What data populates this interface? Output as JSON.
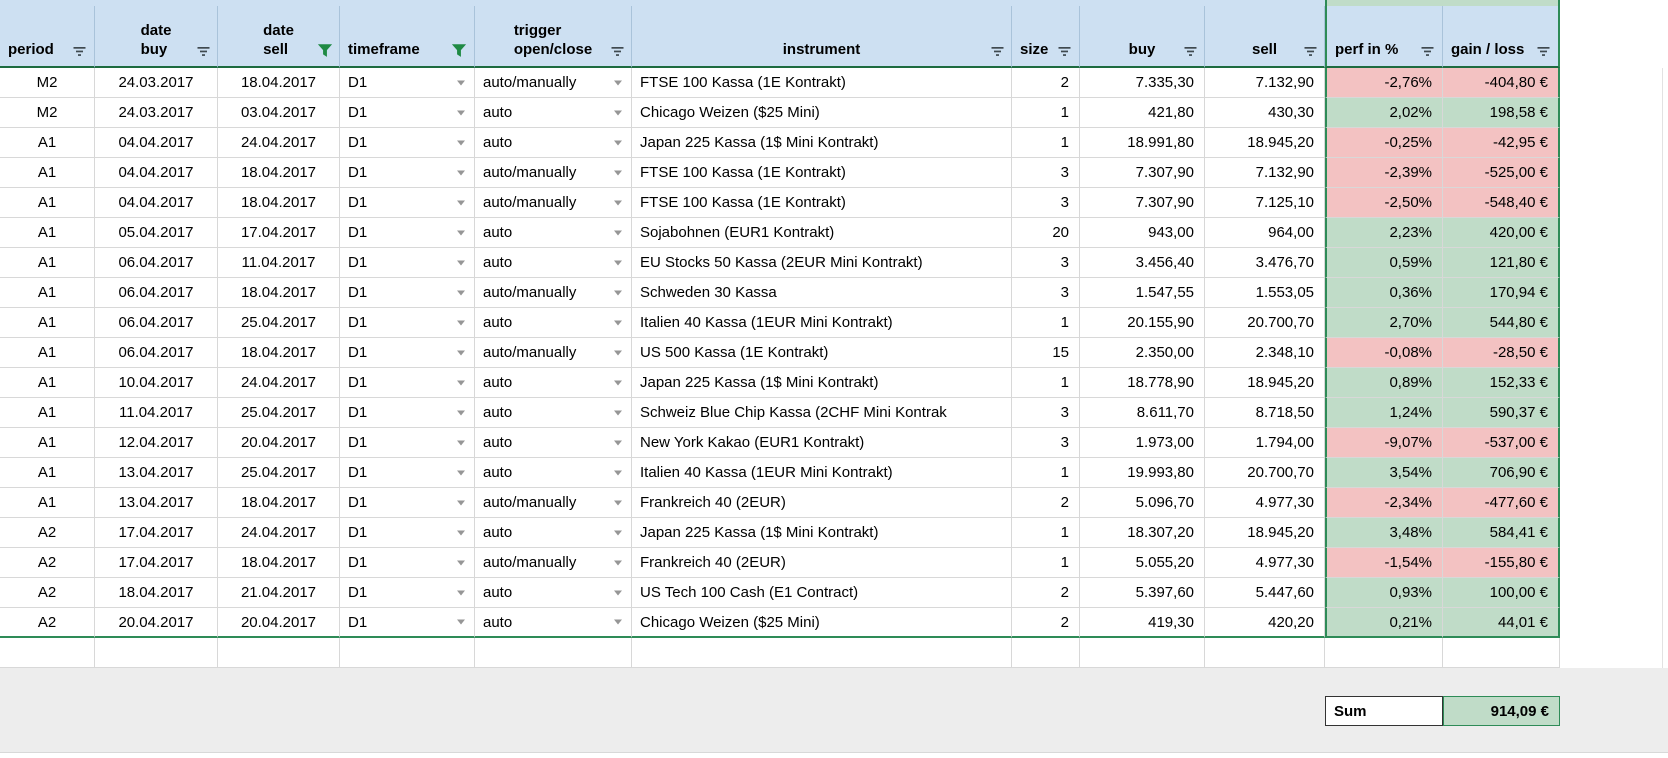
{
  "colors": {
    "header_bg": "#CDE0F2",
    "positive_bg": "#C0DCC8",
    "negative_bg": "#F3C2C2",
    "range_border_green": "#2E8B57",
    "header_underline_green": "#1D6B40",
    "filter_active_green": "#1F8A44",
    "filter_inactive": "#3F4A50",
    "band_grey": "#EDEDED"
  },
  "table": {
    "columns": [
      {
        "label": "period",
        "filter": "inactive"
      },
      {
        "label": "date\nbuy",
        "filter": "inactive"
      },
      {
        "label": "date\nsell",
        "filter": "active"
      },
      {
        "label": "timeframe",
        "filter": "active"
      },
      {
        "label": "trigger\nopen/close",
        "filter": "inactive"
      },
      {
        "label": "instrument",
        "filter": "inactive"
      },
      {
        "label": "size",
        "filter": "inactive"
      },
      {
        "label": "buy",
        "filter": "inactive"
      },
      {
        "label": "sell",
        "filter": "inactive"
      },
      {
        "label": "perf in %",
        "filter": "inactive"
      },
      {
        "label": "gain / loss",
        "filter": "inactive"
      }
    ],
    "rows": [
      {
        "period": "M2",
        "date_buy": "24.03.2017",
        "date_sell": "18.04.2017",
        "timeframe": "D1",
        "trigger": "auto/manually",
        "instrument": "FTSE 100 Kassa (1E Kontrakt)",
        "size": "2",
        "buy": "7.335,30",
        "sell": "7.132,90",
        "perf": "-2,76%",
        "gain": "-404,80 €",
        "sign": "neg"
      },
      {
        "period": "M2",
        "date_buy": "24.03.2017",
        "date_sell": "03.04.2017",
        "timeframe": "D1",
        "trigger": "auto",
        "instrument": "Chicago Weizen ($25 Mini)",
        "size": "1",
        "buy": "421,80",
        "sell": "430,30",
        "perf": "2,02%",
        "gain": "198,58 €",
        "sign": "pos"
      },
      {
        "period": "A1",
        "date_buy": "04.04.2017",
        "date_sell": "24.04.2017",
        "timeframe": "D1",
        "trigger": "auto",
        "instrument": "Japan 225 Kassa (1$ Mini Kontrakt)",
        "size": "1",
        "buy": "18.991,80",
        "sell": "18.945,20",
        "perf": "-0,25%",
        "gain": "-42,95 €",
        "sign": "neg"
      },
      {
        "period": "A1",
        "date_buy": "04.04.2017",
        "date_sell": "18.04.2017",
        "timeframe": "D1",
        "trigger": "auto/manually",
        "instrument": "FTSE 100 Kassa (1E Kontrakt)",
        "size": "3",
        "buy": "7.307,90",
        "sell": "7.132,90",
        "perf": "-2,39%",
        "gain": "-525,00 €",
        "sign": "neg"
      },
      {
        "period": "A1",
        "date_buy": "04.04.2017",
        "date_sell": "18.04.2017",
        "timeframe": "D1",
        "trigger": "auto/manually",
        "instrument": "FTSE 100 Kassa (1E Kontrakt)",
        "size": "3",
        "buy": "7.307,90",
        "sell": "7.125,10",
        "perf": "-2,50%",
        "gain": "-548,40 €",
        "sign": "neg"
      },
      {
        "period": "A1",
        "date_buy": "05.04.2017",
        "date_sell": "17.04.2017",
        "timeframe": "D1",
        "trigger": "auto",
        "instrument": "Sojabohnen (EUR1 Kontrakt)",
        "size": "20",
        "buy": "943,00",
        "sell": "964,00",
        "perf": "2,23%",
        "gain": "420,00 €",
        "sign": "pos"
      },
      {
        "period": "A1",
        "date_buy": "06.04.2017",
        "date_sell": "11.04.2017",
        "timeframe": "D1",
        "trigger": "auto",
        "instrument": "EU Stocks 50 Kassa (2EUR Mini Kontrakt)",
        "size": "3",
        "buy": "3.456,40",
        "sell": "3.476,70",
        "perf": "0,59%",
        "gain": "121,80 €",
        "sign": "pos"
      },
      {
        "period": "A1",
        "date_buy": "06.04.2017",
        "date_sell": "18.04.2017",
        "timeframe": "D1",
        "trigger": "auto/manually",
        "instrument": "Schweden 30 Kassa",
        "size": "3",
        "buy": "1.547,55",
        "sell": "1.553,05",
        "perf": "0,36%",
        "gain": "170,94 €",
        "sign": "pos"
      },
      {
        "period": "A1",
        "date_buy": "06.04.2017",
        "date_sell": "25.04.2017",
        "timeframe": "D1",
        "trigger": "auto",
        "instrument": "Italien 40 Kassa (1EUR Mini Kontrakt)",
        "size": "1",
        "buy": "20.155,90",
        "sell": "20.700,70",
        "perf": "2,70%",
        "gain": "544,80 €",
        "sign": "pos"
      },
      {
        "period": "A1",
        "date_buy": "06.04.2017",
        "date_sell": "18.04.2017",
        "timeframe": "D1",
        "trigger": "auto/manually",
        "instrument": "US 500 Kassa (1E Kontrakt)",
        "size": "15",
        "buy": "2.350,00",
        "sell": "2.348,10",
        "perf": "-0,08%",
        "gain": "-28,50 €",
        "sign": "neg"
      },
      {
        "period": "A1",
        "date_buy": "10.04.2017",
        "date_sell": "24.04.2017",
        "timeframe": "D1",
        "trigger": "auto",
        "instrument": "Japan 225 Kassa (1$ Mini Kontrakt)",
        "size": "1",
        "buy": "18.778,90",
        "sell": "18.945,20",
        "perf": "0,89%",
        "gain": "152,33 €",
        "sign": "pos"
      },
      {
        "period": "A1",
        "date_buy": "11.04.2017",
        "date_sell": "25.04.2017",
        "timeframe": "D1",
        "trigger": "auto",
        "instrument": "Schweiz Blue Chip Kassa (2CHF Mini Kontrak",
        "size": "3",
        "buy": "8.611,70",
        "sell": "8.718,50",
        "perf": "1,24%",
        "gain": "590,37 €",
        "sign": "pos"
      },
      {
        "period": "A1",
        "date_buy": "12.04.2017",
        "date_sell": "20.04.2017",
        "timeframe": "D1",
        "trigger": "auto",
        "instrument": "New York Kakao (EUR1 Kontrakt)",
        "size": "3",
        "buy": "1.973,00",
        "sell": "1.794,00",
        "perf": "-9,07%",
        "gain": "-537,00 €",
        "sign": "neg"
      },
      {
        "period": "A1",
        "date_buy": "13.04.2017",
        "date_sell": "25.04.2017",
        "timeframe": "D1",
        "trigger": "auto",
        "instrument": "Italien 40 Kassa (1EUR Mini Kontrakt)",
        "size": "1",
        "buy": "19.993,80",
        "sell": "20.700,70",
        "perf": "3,54%",
        "gain": "706,90 €",
        "sign": "pos"
      },
      {
        "period": "A1",
        "date_buy": "13.04.2017",
        "date_sell": "18.04.2017",
        "timeframe": "D1",
        "trigger": "auto/manually",
        "instrument": "Frankreich 40 (2EUR)",
        "size": "2",
        "buy": "5.096,70",
        "sell": "4.977,30",
        "perf": "-2,34%",
        "gain": "-477,60 €",
        "sign": "neg"
      },
      {
        "period": "A2",
        "date_buy": "17.04.2017",
        "date_sell": "24.04.2017",
        "timeframe": "D1",
        "trigger": "auto",
        "instrument": "Japan 225 Kassa (1$ Mini Kontrakt)",
        "size": "1",
        "buy": "18.307,20",
        "sell": "18.945,20",
        "perf": "3,48%",
        "gain": "584,41 €",
        "sign": "pos"
      },
      {
        "period": "A2",
        "date_buy": "17.04.2017",
        "date_sell": "18.04.2017",
        "timeframe": "D1",
        "trigger": "auto/manually",
        "instrument": "Frankreich 40 (2EUR)",
        "size": "1",
        "buy": "5.055,20",
        "sell": "4.977,30",
        "perf": "-1,54%",
        "gain": "-155,80 €",
        "sign": "neg"
      },
      {
        "period": "A2",
        "date_buy": "18.04.2017",
        "date_sell": "21.04.2017",
        "timeframe": "D1",
        "trigger": "auto",
        "instrument": "US Tech 100 Cash (E1 Contract)",
        "size": "2",
        "buy": "5.397,60",
        "sell": "5.447,60",
        "perf": "0,93%",
        "gain": "100,00 €",
        "sign": "pos"
      },
      {
        "period": "A2",
        "date_buy": "20.04.2017",
        "date_sell": "20.04.2017",
        "timeframe": "D1",
        "trigger": "auto",
        "instrument": "Chicago Weizen ($25 Mini)",
        "size": "2",
        "buy": "419,30",
        "sell": "420,20",
        "perf": "0,21%",
        "gain": "44,01 €",
        "sign": "pos"
      }
    ],
    "summary": {
      "label": "Sum",
      "value": "914,09 €"
    }
  }
}
